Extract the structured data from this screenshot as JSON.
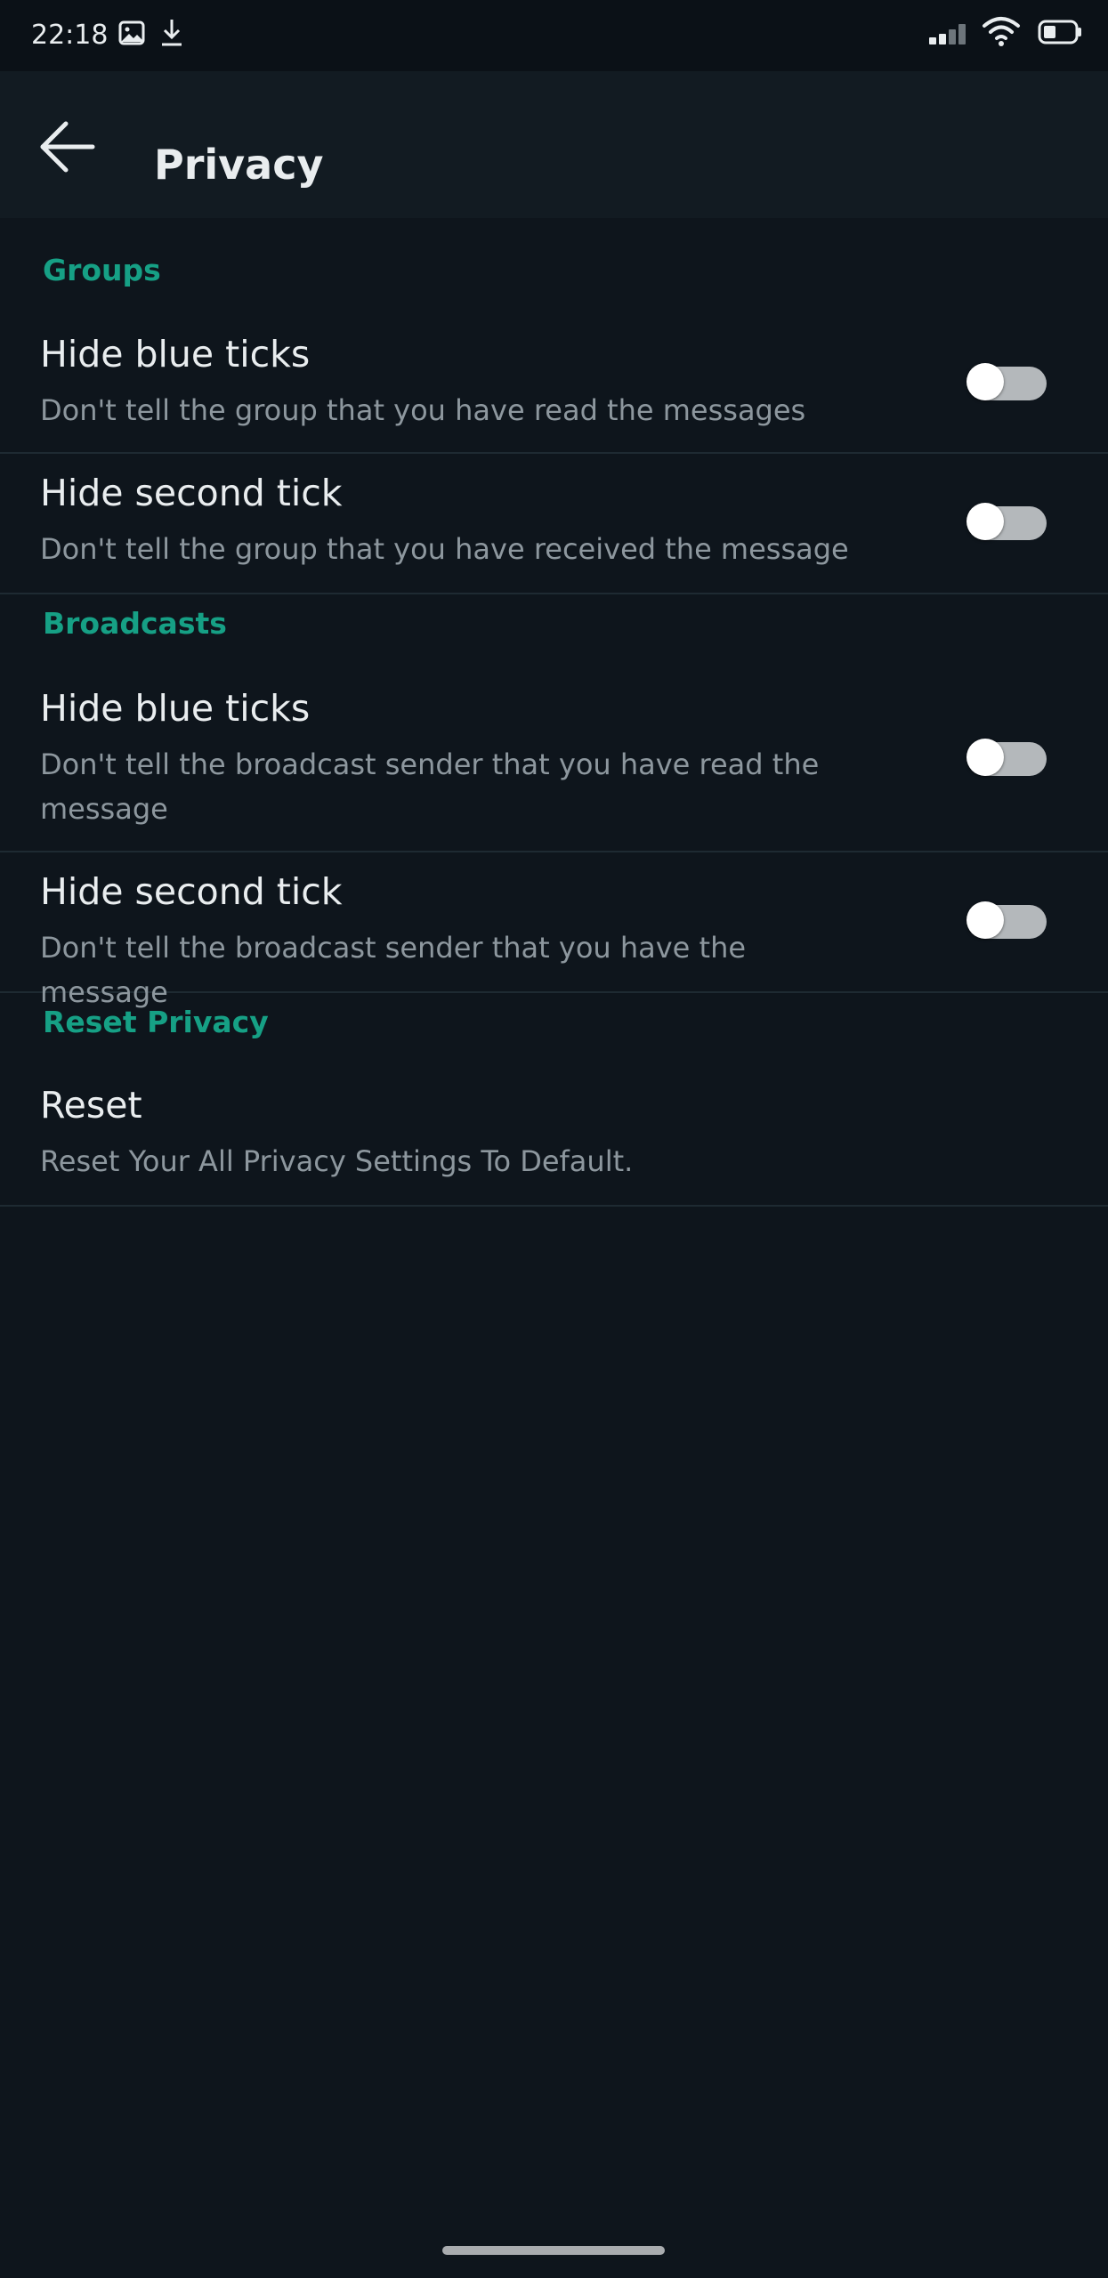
{
  "status_bar": {
    "time": "22:18",
    "icons": [
      "image-icon",
      "download-icon",
      "signal-icon",
      "wifi-icon",
      "battery-icon"
    ]
  },
  "app_bar": {
    "back_icon": "arrow-left-icon",
    "title": "Privacy"
  },
  "sections": [
    {
      "header": "Groups",
      "items": [
        {
          "title": "Hide blue ticks",
          "subtitle": "Don't tell the group that you have read the messages",
          "toggle_on": false
        },
        {
          "title": "Hide second tick",
          "subtitle": "Don't tell the group that you have received the message",
          "toggle_on": false
        }
      ]
    },
    {
      "header": "Broadcasts",
      "items": [
        {
          "title": "Hide blue ticks",
          "subtitle": "Don't tell the broadcast sender that you have read the message",
          "toggle_on": false
        },
        {
          "title": "Hide second tick",
          "subtitle": "Don't tell the broadcast sender that you have the message",
          "toggle_on": false
        }
      ]
    },
    {
      "header": "Reset Privacy",
      "items": [
        {
          "title": "Reset",
          "subtitle": "Reset Your All Privacy Settings To Default."
        }
      ]
    }
  ],
  "colors": {
    "background": "#0e151c",
    "app_bar": "#121b22",
    "accent": "#16a085",
    "primary_text": "#e9edef",
    "secondary_text": "#8d979e",
    "toggle_track_off": "#b4b8bb",
    "toggle_knob": "#ffffff"
  }
}
